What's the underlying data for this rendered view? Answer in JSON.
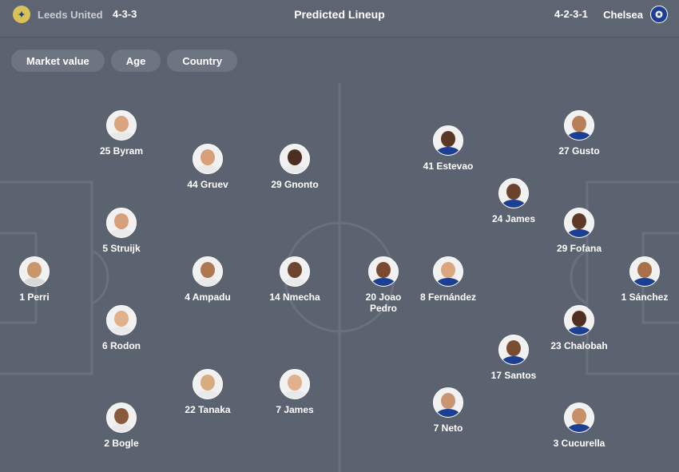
{
  "header": {
    "title": "Predicted Lineup",
    "home": {
      "name": "Leeds United",
      "formation": "4-3-3",
      "crest_icon": "leeds-crest-icon"
    },
    "away": {
      "name": "Chelsea",
      "formation": "4-2-3-1",
      "crest_icon": "chelsea-crest-icon"
    }
  },
  "filters": [
    "Market value",
    "Age",
    "Country"
  ],
  "home_players": [
    {
      "label": "1 Perri",
      "skin": "#c9956a",
      "shirt": "#d8d8d8"
    },
    {
      "label": "25 Byram",
      "skin": "#d9a47e",
      "shirt": "#e9e9e9"
    },
    {
      "label": "5 Struijk",
      "skin": "#d7a07a",
      "shirt": "#e9e9e9"
    },
    {
      "label": "6 Rodon",
      "skin": "#e2b08a",
      "shirt": "#e9e9e9"
    },
    {
      "label": "2 Bogle",
      "skin": "#8a5a3c",
      "shirt": "#e9e9e9"
    },
    {
      "label": "44 Gruev",
      "skin": "#d7a07a",
      "shirt": "#e9e9e9"
    },
    {
      "label": "4 Ampadu",
      "skin": "#b07850",
      "shirt": "#e9e9e9"
    },
    {
      "label": "22 Tanaka",
      "skin": "#d9ac80",
      "shirt": "#e9e9e9"
    },
    {
      "label": "29 Gnonto",
      "skin": "#4a2f22",
      "shirt": "#e9e9e9"
    },
    {
      "label": "14 Nmecha",
      "skin": "#6e4630",
      "shirt": "#e9e9e9"
    },
    {
      "label": "7 James",
      "skin": "#e1b08c",
      "shirt": "#e9e9e9"
    }
  ],
  "away_players": [
    {
      "label": "1 Sánchez",
      "skin": "#a8714a",
      "shirt": "#1c3f94"
    },
    {
      "label": "27 Gusto",
      "skin": "#b98058",
      "shirt": "#1c3f94"
    },
    {
      "label": "29 Fofana",
      "skin": "#5e3a26",
      "shirt": "#1c3f94"
    },
    {
      "label": "23 Chalobah",
      "skin": "#4f3020",
      "shirt": "#1c3f94"
    },
    {
      "label": "3 Cucurella",
      "skin": "#c78f66",
      "shirt": "#1c3f94"
    },
    {
      "label": "24 James",
      "skin": "#6b422c",
      "shirt": "#1c3f94"
    },
    {
      "label": "17 Santos",
      "skin": "#7a4c32",
      "shirt": "#1c3f94"
    },
    {
      "label": "41 Estevao",
      "skin": "#5a3826",
      "shirt": "#1c3f94"
    },
    {
      "label": "8 Fernández",
      "skin": "#d9a67e",
      "shirt": "#1c3f94"
    },
    {
      "label": "7 Neto",
      "skin": "#c99470",
      "shirt": "#1c3f94"
    },
    {
      "label": "20 Joao Pedro",
      "skin": "#7a4a30",
      "shirt": "#1c3f94"
    }
  ]
}
